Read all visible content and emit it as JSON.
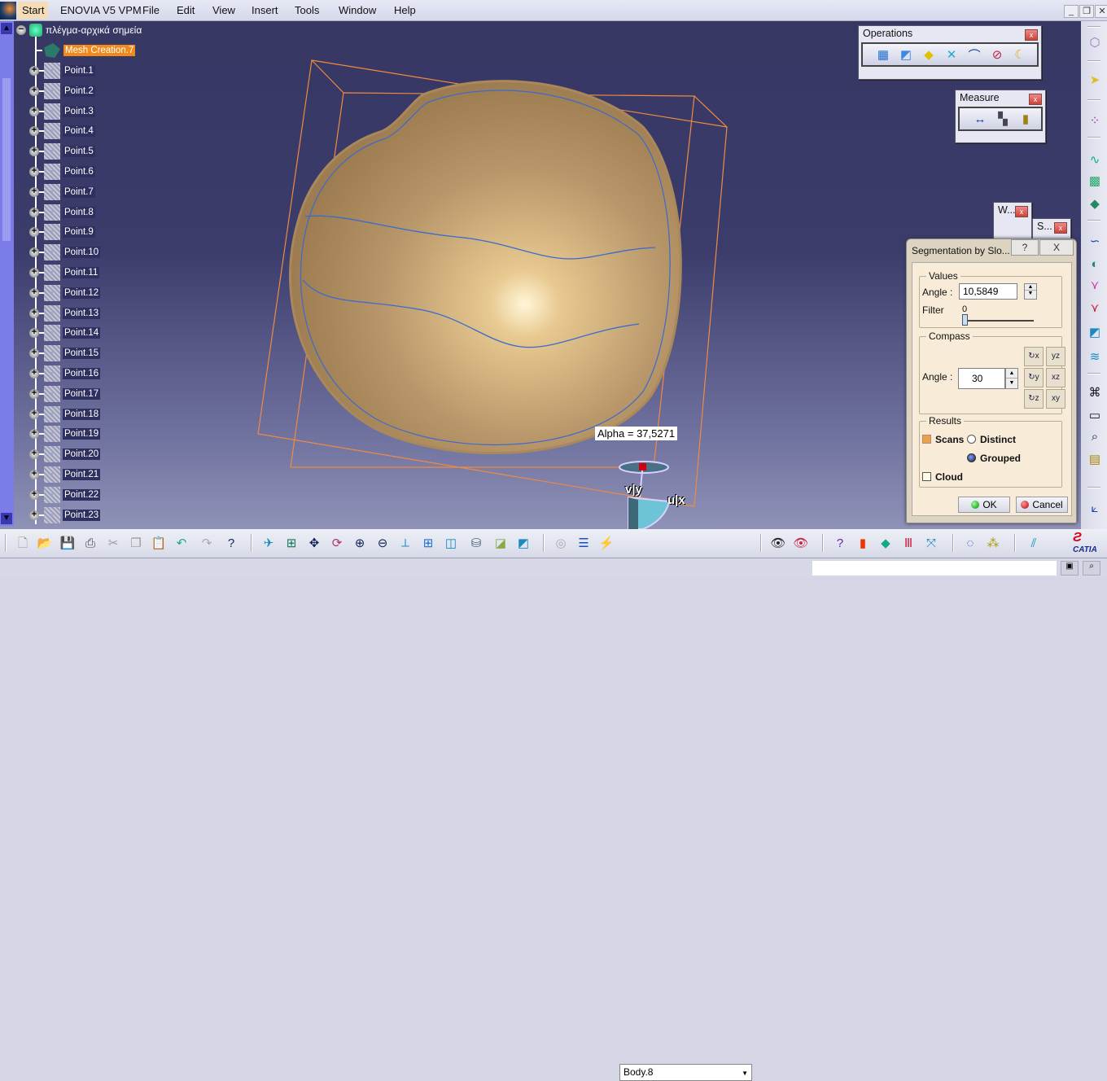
{
  "menubar": {
    "items": [
      "Start",
      "ENOVIA V5 VPM",
      "File",
      "Edit",
      "View",
      "Insert",
      "Tools",
      "Window",
      "Help"
    ],
    "window_controls": {
      "minimize": "_",
      "restore": "❐",
      "close": "✕"
    }
  },
  "tree": {
    "root": "πλέγμα-αρχικά σημεία",
    "selected": "Mesh Creation.7",
    "points": [
      "Point.1",
      "Point.2",
      "Point.3",
      "Point.4",
      "Point.5",
      "Point.6",
      "Point.7",
      "Point.8",
      "Point.9",
      "Point.10",
      "Point.11",
      "Point.12",
      "Point.13",
      "Point.14",
      "Point.15",
      "Point.16",
      "Point.17",
      "Point.18",
      "Point.19",
      "Point.20",
      "Point.21",
      "Point.22",
      "Point.23"
    ]
  },
  "viewport": {
    "alpha_label": "Alpha = 37,5271",
    "axis_v": "v|y",
    "axis_u": "u|x"
  },
  "operations_toolbar": {
    "title": "Operations",
    "icons": [
      "mesh-regions-icon",
      "segment-icon",
      "curve-fill-icon",
      "intersection-icon",
      "projection-icon",
      "remove-icon",
      "shell-icon"
    ]
  },
  "measure_toolbar": {
    "title": "Measure",
    "icons": [
      "measure-between-icon",
      "measure-item-icon",
      "measure-inertia-icon"
    ]
  },
  "mini_toolbars": {
    "w": "W...",
    "s": "S..."
  },
  "dialog": {
    "title": "Segmentation by Slo...",
    "help": "?",
    "close": "X",
    "values": {
      "label": "Values",
      "angle_label": "Angle :",
      "angle_value": "10,5849",
      "filter_label": "Filter",
      "filter_value": "0"
    },
    "compass": {
      "label": "Compass",
      "angle_label": "Angle :",
      "angle_value": "30"
    },
    "results": {
      "label": "Results",
      "scans": "Scans",
      "distinct": "Distinct",
      "grouped": "Grouped",
      "cloud": "Cloud",
      "scans_checked": true,
      "mode": "Grouped",
      "cloud_checked": false
    },
    "ok": "OK",
    "cancel": "Cancel"
  },
  "bottom_toolbar": {
    "current_body": "Body.8"
  },
  "brand": {
    "logo": "CATIA"
  }
}
